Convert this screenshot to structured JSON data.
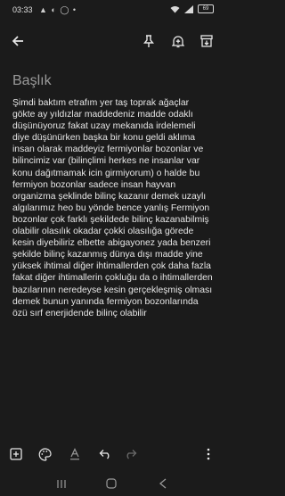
{
  "status_bar": {
    "time": "03:33",
    "extra_indicators": "▲ ◐ ◯ •",
    "battery": "69"
  },
  "toolbar": {
    "back_icon": "back-arrow-icon",
    "pin_icon": "pin-icon",
    "reminder_icon": "bell-plus-icon",
    "archive_icon": "archive-icon"
  },
  "note": {
    "title": "Başlık",
    "body": "Şimdi baktım etrafım yer taş toprak ağaçlar gökte ay yıldızlar maddedeniz madde odaklı düşünüyoruz fakat uzay mekanıda irdelemeli diye düşünürken başka bir konu geldi aklıma insan olarak maddeyiz fermiyonlar bozonlar ve bilincimiz var (bilinçlimi herkes ne insanlar var konu dağıtmamak icin girmiyorum) o halde bu fermiyon bozonlar sadece insan hayvan organizma şeklinde bilinç kazanır demek uzaylı algılarımız heo bu yönde bence yanlış Fermiyon bozonlar çok farklı şekildede bilinç kazanabilmiş olabilir olasılık okadar çokki olasılığa görede kesin diyebiliriz elbette abigayonez yada benzeri şekilde bilinç kazanmış dünya dışı madde yine yüksek ihtimal diğer ihtimallerden çok daha fazla fakat diğer ihtimallerin çokluğu da o ihtimallerden bazılarının neredeyse kesin gerçekleşmiş olması demek bunun yanında fermiyon bozonlarında özü sırf enerjidende bilinç olabilir"
  },
  "bottom_toolbar": {
    "add_icon": "add-box-icon",
    "palette_icon": "palette-icon",
    "text_format_icon": "text-format-icon",
    "undo_icon": "undo-icon",
    "redo_icon": "redo-icon",
    "more_icon": "more-vert-icon"
  },
  "nav_bar": {
    "recents_icon": "recents-icon",
    "home_icon": "home-icon",
    "back_icon": "nav-back-icon"
  }
}
